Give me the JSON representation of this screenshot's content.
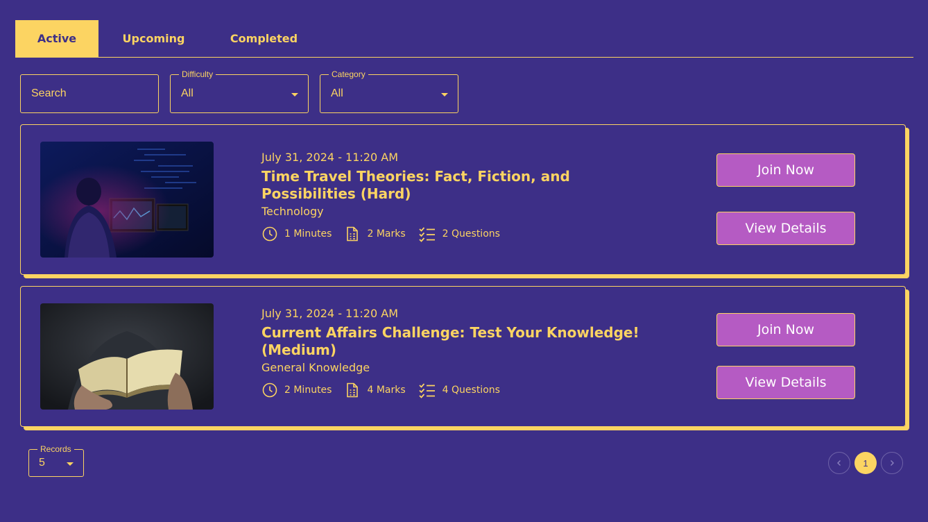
{
  "tabs": [
    {
      "label": "Active"
    },
    {
      "label": "Upcoming"
    },
    {
      "label": "Completed"
    }
  ],
  "filters": {
    "search": {
      "placeholder": "Search"
    },
    "difficulty": {
      "legend": "Difficulty",
      "value": "All"
    },
    "category": {
      "legend": "Category",
      "value": "All"
    }
  },
  "quizzes": [
    {
      "date": "July 31, 2024 - 11:20 AM",
      "title": "Time Travel Theories: Fact, Fiction, and Possibilities (Hard)",
      "category": "Technology",
      "duration": "1 Minutes",
      "marks": "2 Marks",
      "questions": "2 Questions",
      "join_label": "Join Now",
      "details_label": "View Details"
    },
    {
      "date": "July 31, 2024 - 11:20 AM",
      "title": "Current Affairs Challenge: Test Your Knowledge! (Medium)",
      "category": "General Knowledge",
      "duration": "2 Minutes",
      "marks": "4 Marks",
      "questions": "4 Questions",
      "join_label": "Join Now",
      "details_label": "View Details"
    }
  ],
  "pagination": {
    "records_legend": "Records",
    "records_value": "5",
    "current_page": "1"
  },
  "colors": {
    "background": "#3d2f87",
    "accent": "#fcd462",
    "button": "#b55bc3"
  }
}
